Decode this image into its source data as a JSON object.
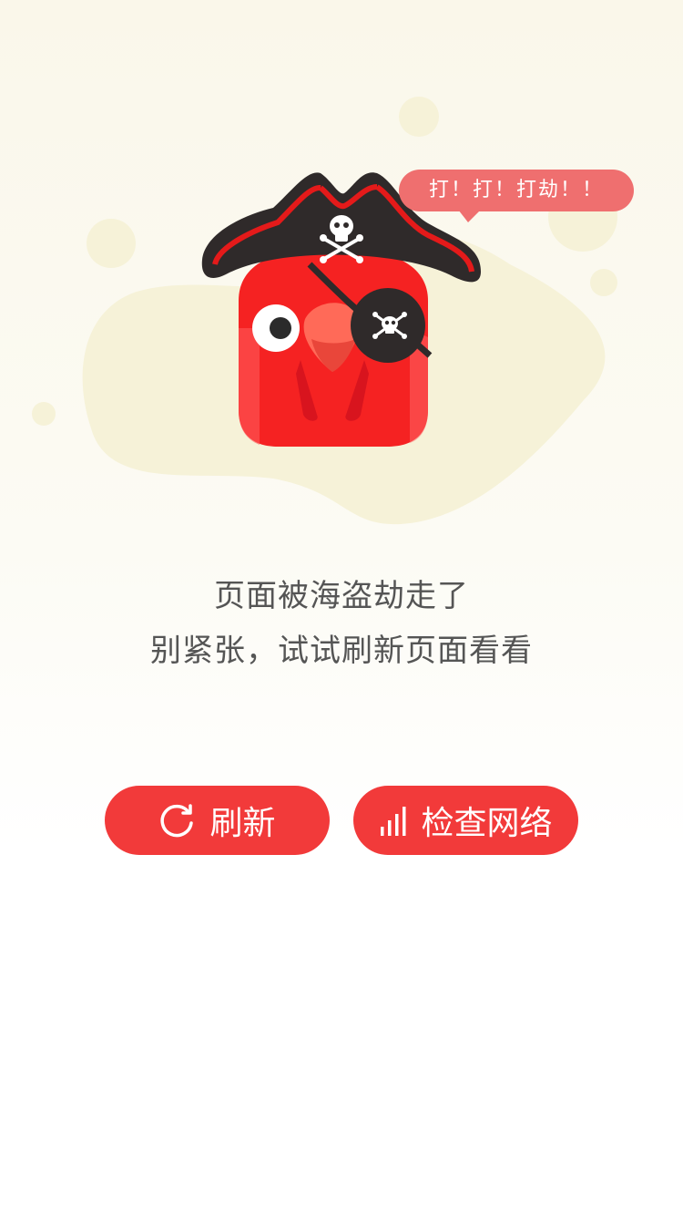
{
  "speech_bubble": {
    "text": "打！打！打劫！！"
  },
  "message": {
    "line1": "页面被海盗劫走了",
    "line2": "别紧张，试试刷新页面看看"
  },
  "buttons": {
    "refresh": {
      "label": "刷新",
      "icon": "refresh-icon"
    },
    "check_network": {
      "label": "检查网络",
      "icon": "signal-bars-icon"
    }
  },
  "colors": {
    "accent": "#f23a3a",
    "bubble": "#ef6f6f",
    "background": "#faf7ea"
  }
}
